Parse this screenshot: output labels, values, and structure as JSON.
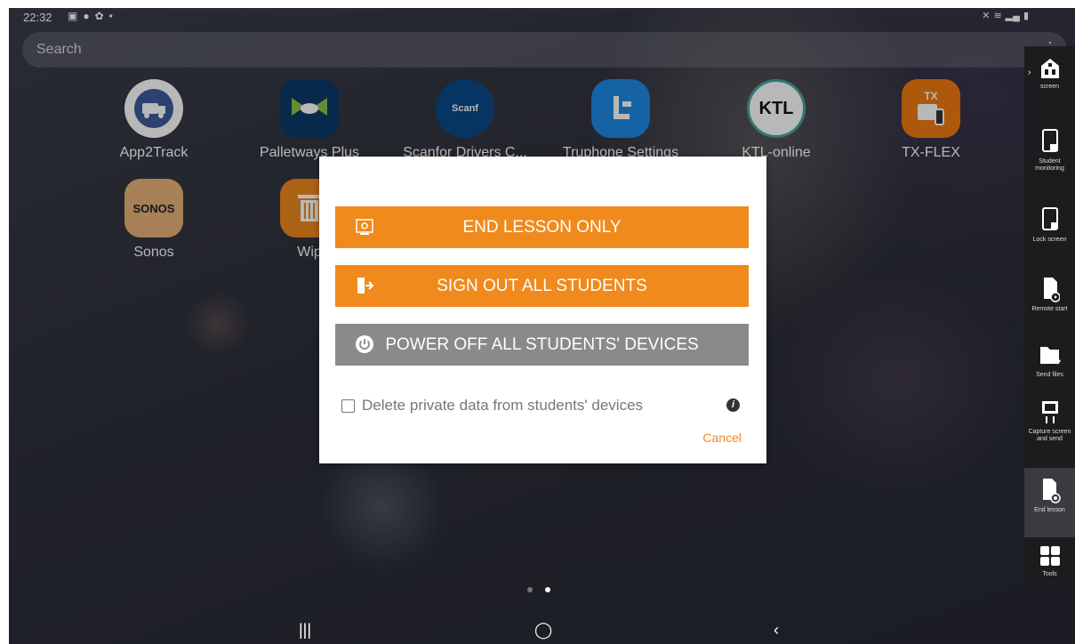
{
  "status": {
    "time": "22:32",
    "icons": [
      "image-icon",
      "android-icon",
      "gear-icon",
      "dot"
    ]
  },
  "search": {
    "placeholder": "Search"
  },
  "apps": [
    {
      "label": "App2Track",
      "icon": "app2track-icon",
      "color": "#ffffff"
    },
    {
      "label": "Palletways Plus",
      "icon": "palletways-icon",
      "color": "#0b3a6a"
    },
    {
      "label": "Scanfor Drivers C...",
      "icon": "scanfor-icon",
      "icon_text": "Scanf",
      "color": "#0b4a8a"
    },
    {
      "label": "Truphone Settings",
      "icon": "truphone-icon",
      "color": "#1e88e5"
    },
    {
      "label": "KTL-online",
      "icon": "ktl-icon",
      "icon_text": "KTL",
      "color": "#ffffff"
    },
    {
      "label": "TX-FLEX",
      "icon": "txflex-icon",
      "icon_text": "TX",
      "color": "#f07a10"
    },
    {
      "label": "Sonos",
      "icon": "sonos-icon",
      "icon_text": "SONOS",
      "color": "#e8b27a"
    },
    {
      "label": "Wip",
      "icon": "trash-icon",
      "color": "#f08a1c"
    }
  ],
  "dialog": {
    "end_lesson": "END LESSON ONLY",
    "sign_out": "SIGN OUT ALL STUDENTS",
    "power_off": "POWER OFF ALL STUDENTS' DEVICES",
    "delete_private": "Delete private data from students' devices",
    "cancel": "Cancel"
  },
  "toolbar": [
    {
      "label": "screen",
      "icon": "school-icon"
    },
    {
      "label": "Student monitoring",
      "icon": "tablet-monitor-icon"
    },
    {
      "label": "Lock screen",
      "icon": "tablet-lock-icon"
    },
    {
      "label": "Remote start",
      "icon": "remote-start-icon"
    },
    {
      "label": "Send files",
      "icon": "folder-send-icon"
    },
    {
      "label": "Capture screen and send",
      "icon": "capture-icon"
    },
    {
      "label": "End lesson",
      "icon": "end-lesson-icon"
    },
    {
      "label": "Tools",
      "icon": "tools-icon"
    }
  ],
  "colors": {
    "accent": "#f08a1c",
    "grey_button": "#8a8a8a"
  },
  "pages": {
    "count": 2,
    "current": 2
  }
}
